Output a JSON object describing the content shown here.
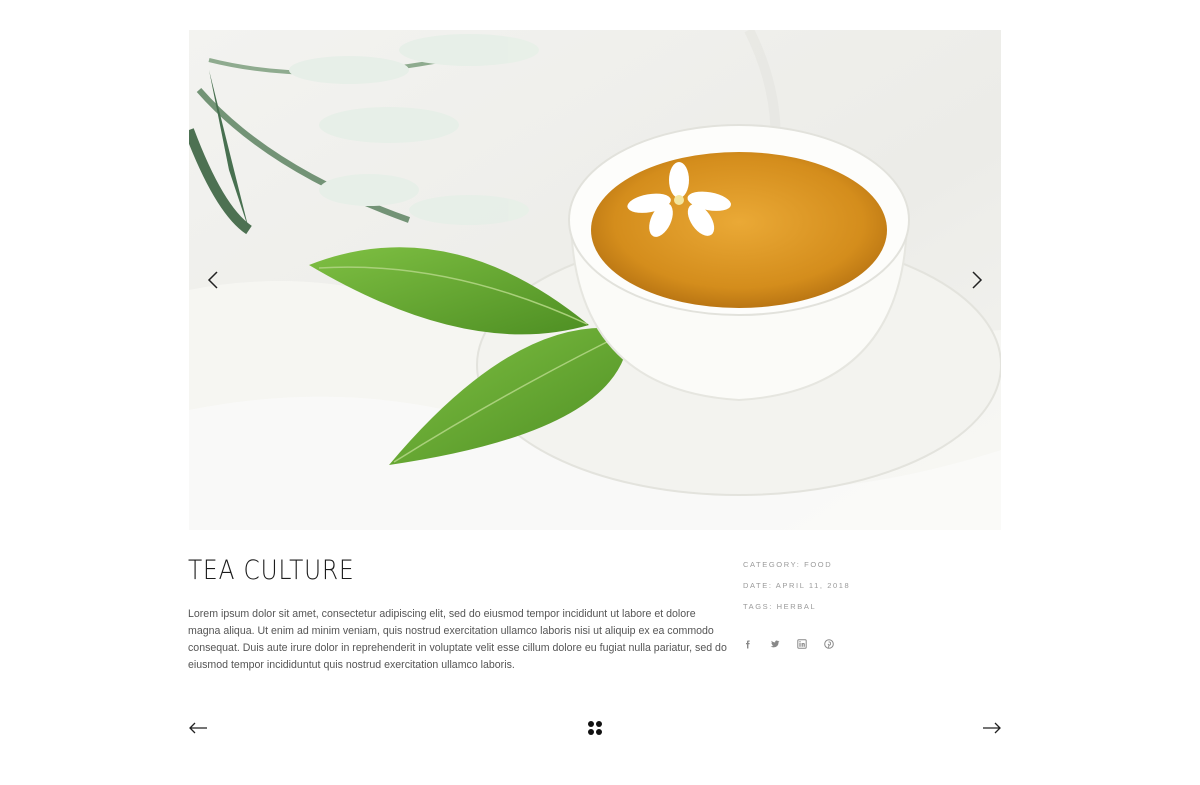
{
  "post": {
    "title": "TEA CULTURE",
    "excerpt": "Lorem ipsum dolor sit amet, consectetur adipiscing elit, sed do eiusmod tempor incididunt ut labore et dolore magna aliqua. Ut enim ad minim veniam, quis nostrud exercitation ullamco laboris nisi ut aliquip ex ea commodo consequat. Duis aute irure dolor in reprehenderit in voluptate velit esse cillum dolore eu fugiat nulla pariatur, sed do eiusmod tempor incididuntut quis nostrud exercitation ullamco laboris."
  },
  "meta": {
    "category": "CATEGORY: FOOD",
    "date": "DATE: APRIL 11, 2018",
    "tags": "TAGS: HERBAL"
  },
  "social": [
    "facebook-icon",
    "twitter-icon",
    "linkedin-icon",
    "pinterest-icon"
  ],
  "slider": {
    "prev_icon": "chevron-left-icon",
    "next_icon": "chevron-right-icon"
  },
  "pagination": {
    "prev_icon": "arrow-left-icon",
    "grid_icon": "grid-icon",
    "next_icon": "arrow-right-icon"
  },
  "colors": {
    "text": "#222222",
    "meta": "#9a9a9a",
    "tea": "#d9941e",
    "leaf": "#5f9f2c"
  }
}
